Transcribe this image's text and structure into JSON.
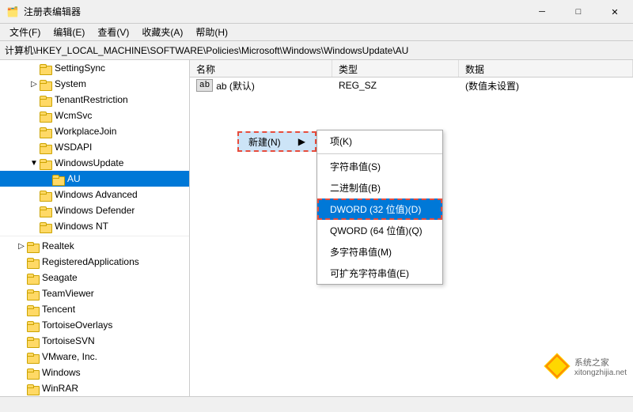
{
  "titleBar": {
    "icon": "📋",
    "title": "注册表编辑器",
    "minBtn": "─",
    "maxBtn": "□",
    "closeBtn": "✕"
  },
  "menuBar": {
    "items": [
      {
        "label": "文件(F)"
      },
      {
        "label": "编辑(E)"
      },
      {
        "label": "查看(V)"
      },
      {
        "label": "收藏夹(A)"
      },
      {
        "label": "帮助(H)"
      }
    ]
  },
  "addressBar": {
    "path": "计算机\\HKEY_LOCAL_MACHINE\\SOFTWARE\\Policies\\Microsoft\\Windows\\WindowsUpdate\\AU"
  },
  "tree": {
    "items": [
      {
        "indent": 1,
        "hasArrow": false,
        "arrowChar": "",
        "label": "SettingSync",
        "selected": false
      },
      {
        "indent": 1,
        "hasArrow": true,
        "arrowChar": "▷",
        "label": "System",
        "selected": false
      },
      {
        "indent": 1,
        "hasArrow": false,
        "arrowChar": "",
        "label": "TenantRestriction",
        "selected": false
      },
      {
        "indent": 1,
        "hasArrow": false,
        "arrowChar": "",
        "label": "WcmSvc",
        "selected": false
      },
      {
        "indent": 1,
        "hasArrow": false,
        "arrowChar": "",
        "label": "WorkplaceJoin",
        "selected": false
      },
      {
        "indent": 1,
        "hasArrow": false,
        "arrowChar": "",
        "label": "WSDAPI",
        "selected": false
      },
      {
        "indent": 1,
        "hasArrow": true,
        "arrowChar": "▼",
        "label": "WindowsUpdate",
        "selected": false
      },
      {
        "indent": 2,
        "hasArrow": false,
        "arrowChar": "",
        "label": "AU",
        "selected": true
      },
      {
        "indent": 1,
        "hasArrow": false,
        "arrowChar": "",
        "label": "Windows Advanced",
        "selected": false
      },
      {
        "indent": 1,
        "hasArrow": false,
        "arrowChar": "",
        "label": "Windows Defender",
        "selected": false
      },
      {
        "indent": 1,
        "hasArrow": false,
        "arrowChar": "",
        "label": "Windows NT",
        "selected": false
      }
    ],
    "items2": [
      {
        "indent": 0,
        "hasArrow": true,
        "arrowChar": "▷",
        "label": "Realtek",
        "selected": false
      },
      {
        "indent": 0,
        "hasArrow": false,
        "arrowChar": "",
        "label": "RegisteredApplications",
        "selected": false
      },
      {
        "indent": 0,
        "hasArrow": false,
        "arrowChar": "",
        "label": "Seagate",
        "selected": false
      },
      {
        "indent": 0,
        "hasArrow": false,
        "arrowChar": "",
        "label": "TeamViewer",
        "selected": false
      },
      {
        "indent": 0,
        "hasArrow": false,
        "arrowChar": "",
        "label": "Tencent",
        "selected": false
      },
      {
        "indent": 0,
        "hasArrow": false,
        "arrowChar": "",
        "label": "TortoiseOverlays",
        "selected": false
      },
      {
        "indent": 0,
        "hasArrow": false,
        "arrowChar": "",
        "label": "TortoiseSVN",
        "selected": false
      },
      {
        "indent": 0,
        "hasArrow": false,
        "arrowChar": "",
        "label": "VMware, Inc.",
        "selected": false
      },
      {
        "indent": 0,
        "hasArrow": false,
        "arrowChar": "",
        "label": "Windows",
        "selected": false
      },
      {
        "indent": 0,
        "hasArrow": false,
        "arrowChar": "",
        "label": "WinRAR",
        "selected": false
      }
    ]
  },
  "columns": {
    "headers": [
      "名称",
      "类型",
      "数据"
    ]
  },
  "rows": [
    {
      "name": "ab (默认)",
      "type": "REG_SZ",
      "data": "(数值未设置)"
    }
  ],
  "contextMenu": {
    "newBtn": "新建(N)",
    "arrow": "▶",
    "submenuItems": [
      {
        "label": "项(K)",
        "highlighted": false
      },
      {
        "label": "",
        "isSeparator": true
      },
      {
        "label": "字符串值(S)",
        "highlighted": false
      },
      {
        "label": "二进制值(B)",
        "highlighted": false
      },
      {
        "label": "DWORD (32 位值)(D)",
        "highlighted": true
      },
      {
        "label": "QWORD (64 位值)(Q)",
        "highlighted": false
      },
      {
        "label": "多字符串值(M)",
        "highlighted": false
      },
      {
        "label": "可扩充字符串值(E)",
        "highlighted": false
      }
    ]
  },
  "watermark": {
    "text": "系统之家",
    "subtext": "xitongzhijia.net"
  }
}
